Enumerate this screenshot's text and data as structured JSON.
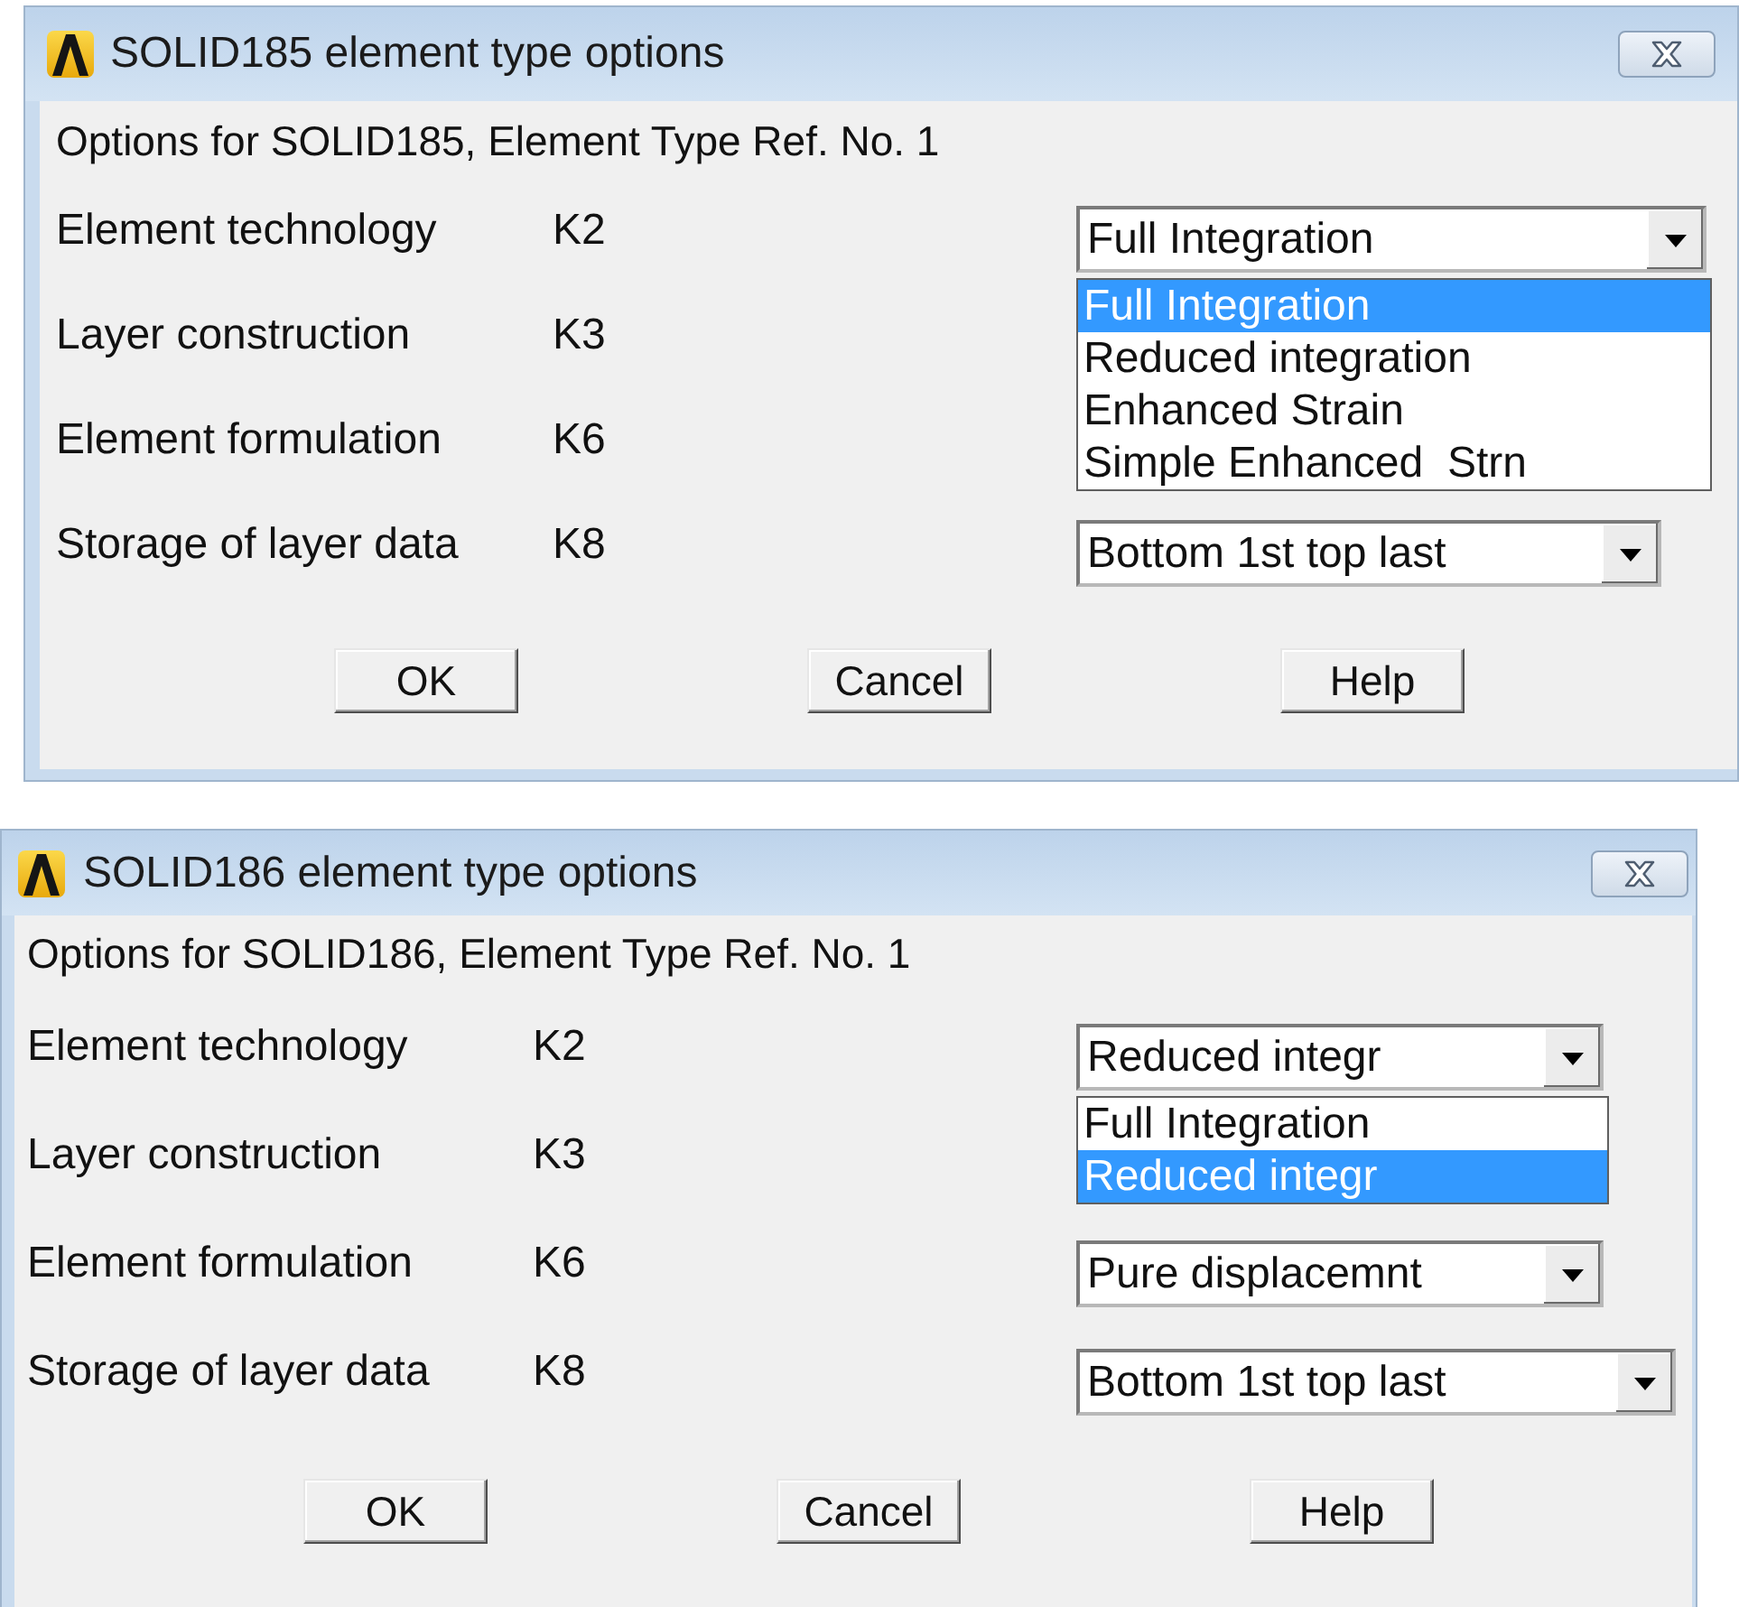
{
  "dialogs": [
    {
      "title": "SOLID185 element type options",
      "heading": "Options for SOLID185, Element Type Ref. No. 1",
      "options": [
        {
          "label": "Element technology",
          "key": "K2",
          "value": "Full Integration",
          "open_list": [
            {
              "label": "Full Integration",
              "selected": true
            },
            {
              "label": "Reduced integration",
              "selected": false
            },
            {
              "label": "Enhanced Strain",
              "selected": false
            },
            {
              "label": "Simple Enhanced  Strn",
              "selected": false
            }
          ]
        },
        {
          "label": "Layer construction",
          "key": "K3"
        },
        {
          "label": "Element formulation",
          "key": "K6"
        },
        {
          "label": "Storage of layer data",
          "key": "K8",
          "value": "Bottom 1st top last"
        }
      ],
      "buttons": [
        "OK",
        "Cancel",
        "Help"
      ]
    },
    {
      "title": "SOLID186 element type options",
      "heading": "Options for SOLID186, Element Type Ref. No. 1",
      "options": [
        {
          "label": "Element technology",
          "key": "K2",
          "value": "Reduced integr",
          "open_list": [
            {
              "label": "Full Integration",
              "selected": false
            },
            {
              "label": "Reduced integr",
              "selected": true
            }
          ]
        },
        {
          "label": "Layer construction",
          "key": "K3"
        },
        {
          "label": "Element formulation",
          "key": "K6",
          "value": "Pure displacemnt"
        },
        {
          "label": "Storage of layer data",
          "key": "K8",
          "value": "Bottom 1st top last"
        }
      ],
      "buttons": [
        "OK",
        "Cancel",
        "Help"
      ]
    }
  ]
}
